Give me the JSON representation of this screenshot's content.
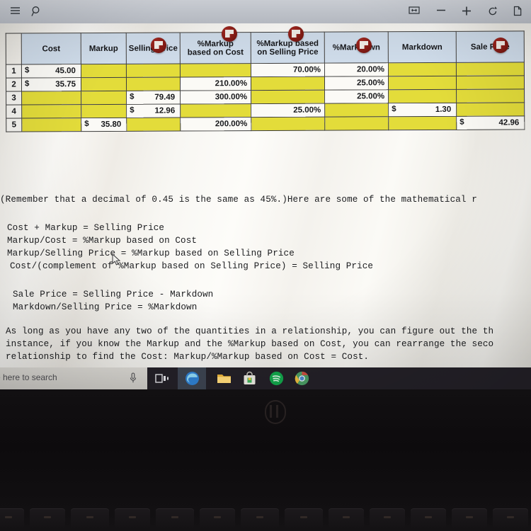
{
  "toolbar": {
    "left_icons": [
      {
        "name": "menu-icon",
        "glyph": "hamburger"
      },
      {
        "name": "search-icon",
        "glyph": "magnifier"
      }
    ],
    "right_icons": [
      {
        "name": "fit-width-icon",
        "glyph": "fit"
      },
      {
        "name": "zoom-out-icon",
        "glyph": "minus"
      },
      {
        "name": "zoom-in-icon",
        "glyph": "plus"
      },
      {
        "name": "rotate-icon",
        "glyph": "rotate"
      },
      {
        "name": "page-view-icon",
        "glyph": "page"
      }
    ]
  },
  "table": {
    "headers": [
      "Cost",
      "Markup",
      "Selling Price",
      "%Markup based on Cost",
      "%Markup based on Selling Price",
      "%Markdown",
      "Markdown",
      "Sale Price"
    ],
    "headers_line1": [
      "Cost",
      "Markup",
      "Selling Price",
      "%Markup",
      "%Markup based",
      "%Markdown",
      "Markdown",
      "Sale Price"
    ],
    "headers_line2": [
      "",
      "",
      "",
      "based on Cost",
      "on Selling Price",
      "",
      "",
      ""
    ],
    "row_numbers": [
      "1",
      "2",
      "3",
      "4",
      "5"
    ],
    "rows": [
      {
        "num": "1",
        "cells": [
          {
            "type": "money",
            "sym": "$",
            "value": "45.00"
          },
          {
            "type": "fill",
            "value": ""
          },
          {
            "type": "fill",
            "value": ""
          },
          {
            "type": "fill",
            "value": ""
          },
          {
            "type": "pct",
            "value": "70.00%"
          },
          {
            "type": "pct",
            "value": "20.00%"
          },
          {
            "type": "fill",
            "value": ""
          },
          {
            "type": "fill",
            "value": ""
          }
        ]
      },
      {
        "num": "2",
        "cells": [
          {
            "type": "money",
            "sym": "$",
            "value": "35.75"
          },
          {
            "type": "fill",
            "value": ""
          },
          {
            "type": "fill",
            "value": ""
          },
          {
            "type": "pct",
            "value": "210.00%"
          },
          {
            "type": "fill",
            "value": ""
          },
          {
            "type": "pct",
            "value": "25.00%"
          },
          {
            "type": "fill",
            "value": ""
          },
          {
            "type": "fill",
            "value": ""
          }
        ]
      },
      {
        "num": "3",
        "cells": [
          {
            "type": "fill",
            "value": ""
          },
          {
            "type": "fill",
            "value": ""
          },
          {
            "type": "money",
            "sym": "$",
            "value": "79.49"
          },
          {
            "type": "pct",
            "value": "300.00%"
          },
          {
            "type": "fill",
            "value": ""
          },
          {
            "type": "pct",
            "value": "25.00%"
          },
          {
            "type": "fill",
            "value": ""
          },
          {
            "type": "fill",
            "value": ""
          }
        ]
      },
      {
        "num": "4",
        "cells": [
          {
            "type": "fill",
            "value": ""
          },
          {
            "type": "fill",
            "value": ""
          },
          {
            "type": "money",
            "sym": "$",
            "value": "12.96"
          },
          {
            "type": "fill",
            "value": ""
          },
          {
            "type": "pct",
            "value": "25.00%"
          },
          {
            "type": "fill",
            "value": ""
          },
          {
            "type": "money",
            "sym": "$",
            "value": "1.30"
          },
          {
            "type": "fill",
            "value": ""
          }
        ]
      },
      {
        "num": "5",
        "cells": [
          {
            "type": "fill",
            "value": ""
          },
          {
            "type": "money",
            "sym": "$",
            "value": "35.80"
          },
          {
            "type": "fill",
            "value": ""
          },
          {
            "type": "pct",
            "value": "200.00%"
          },
          {
            "type": "fill",
            "value": ""
          },
          {
            "type": "fill",
            "value": ""
          },
          {
            "type": "fill",
            "value": ""
          },
          {
            "type": "money",
            "sym": "$",
            "value": "42.96"
          }
        ]
      }
    ],
    "comment_markers": 5,
    "colors": {
      "header_fill": "#cfdcea",
      "blank_fill": "#e3dc3a",
      "value_fill": "#fbfaf6",
      "marker": "#7c1812"
    }
  },
  "body_text": {
    "intro": "(Remember that a decimal of 0.45 is the same as 45%.)Here are some of the mathematical r",
    "formulas_group1": [
      "Cost + Markup = Selling Price",
      "Markup/Cost = %Markup based on Cost",
      "Markup/Selling Price = %Markup based on Selling Price",
      "Cost/(complement of %Markup based on Selling Price) = Selling Price"
    ],
    "formulas_group2": [
      "Sale Price = Selling Price - Markdown",
      "Markdown/Selling Price = %Markdown"
    ],
    "paragraph": [
      "As long as you have any two of the quantities in a relationship, you can figure out the th",
      "instance, if you know the Markup and the %Markup based on Cost, you can rearrange the seco",
      "relationship to find the Cost: Markup/%Markup based on Cost = Cost."
    ]
  },
  "taskbar": {
    "search_placeholder": "e here to search",
    "icons": [
      {
        "name": "microphone-icon"
      },
      {
        "name": "task-view-icon"
      },
      {
        "name": "edge-browser-icon"
      },
      {
        "name": "file-explorer-icon"
      },
      {
        "name": "microsoft-store-icon"
      },
      {
        "name": "spotify-icon"
      },
      {
        "name": "chrome-icon"
      }
    ]
  },
  "device": {
    "brand": "hp"
  }
}
